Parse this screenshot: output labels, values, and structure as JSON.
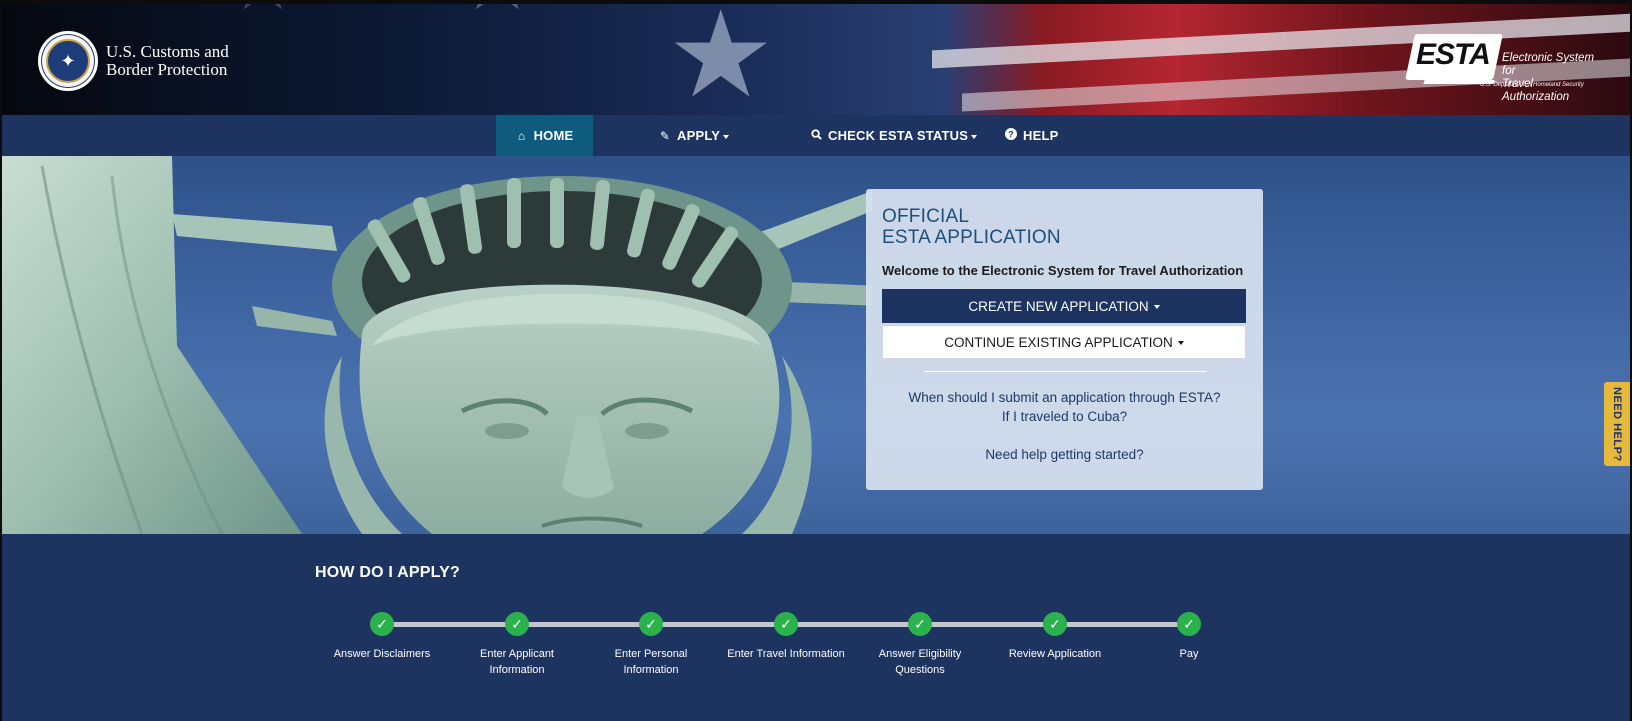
{
  "header": {
    "agency_line1": "U.S. Customs and",
    "agency_line2": "Border Protection",
    "esta_mark": "ESTA",
    "esta_desc_line1": "Electronic System for",
    "esta_desc_line2": "Travel Authorization",
    "esta_dhs": "U.S. Department of Homeland Security"
  },
  "nav": {
    "items": [
      {
        "label": "HOME",
        "icon": "home-icon",
        "active": true
      },
      {
        "label": "APPLY",
        "icon": "pencil-icon",
        "dropdown": true
      },
      {
        "label": "CHECK ESTA STATUS",
        "icon": "search-icon",
        "dropdown": true
      },
      {
        "label": "HELP",
        "icon": "question-circle-icon"
      }
    ]
  },
  "card": {
    "title_line1": "OFFICIAL",
    "title_line2": "ESTA APPLICATION",
    "welcome": "Welcome to the Electronic System for Travel Authorization",
    "create_button": "CREATE NEW APPLICATION",
    "continue_button": "CONTINUE EXISTING APPLICATION",
    "link_when": "When should I submit an application through ESTA?",
    "link_cuba": "If I traveled to Cuba?",
    "link_help": "Need help getting started?"
  },
  "need_help_tab": "NEED HELP?",
  "how_to_apply": {
    "title": "HOW DO I APPLY?",
    "steps": [
      {
        "line1": "Answer Disclaimers",
        "line2": "",
        "done": true
      },
      {
        "line1": "Enter Applicant",
        "line2": "Information",
        "done": true
      },
      {
        "line1": "Enter Personal",
        "line2": "Information",
        "done": true
      },
      {
        "line1": "Enter Travel Information",
        "line2": "",
        "done": true
      },
      {
        "line1": "Answer Eligibility",
        "line2": "Questions",
        "done": true
      },
      {
        "line1": "Review Application",
        "line2": "",
        "done": true
      },
      {
        "line1": "Pay",
        "line2": "",
        "done": true
      }
    ]
  },
  "colors": {
    "navy": "#1d3461",
    "active_tab": "#0f5a7f",
    "step_check": "#2bb24c",
    "help_tab": "#e6b93a"
  }
}
